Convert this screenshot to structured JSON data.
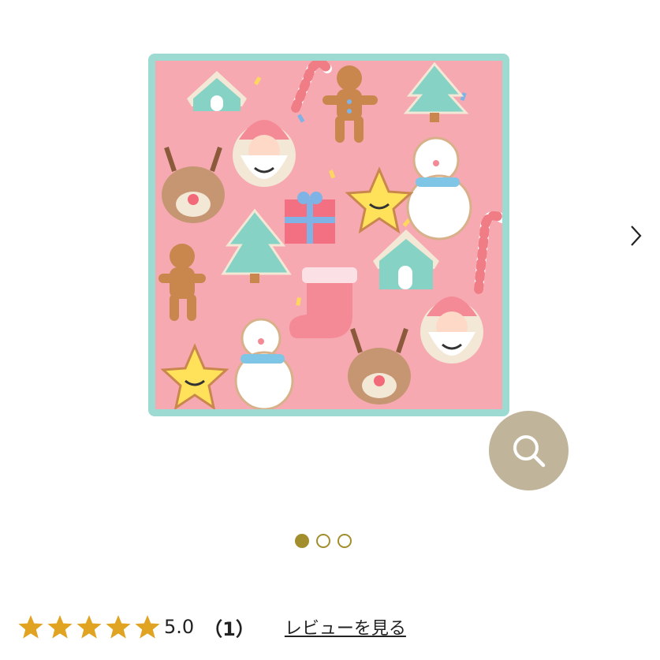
{
  "product": {
    "image_description_icon": "christmas-cookie-towel-image"
  },
  "carousel": {
    "next_icon": "chevron-right-icon",
    "zoom_icon": "magnifier-icon",
    "pages": [
      {
        "active": true
      },
      {
        "active": false
      },
      {
        "active": false
      }
    ]
  },
  "rating": {
    "stars": 5,
    "value": "5.0",
    "count": "（1）",
    "review_link": "レビューを見る",
    "star_color": "#e0a322"
  },
  "colors": {
    "accent": "#a38e2e",
    "zoom_bg": "#c0b49a",
    "towel_pink": "#f6a9b1",
    "towel_border": "#9ddbd2"
  }
}
